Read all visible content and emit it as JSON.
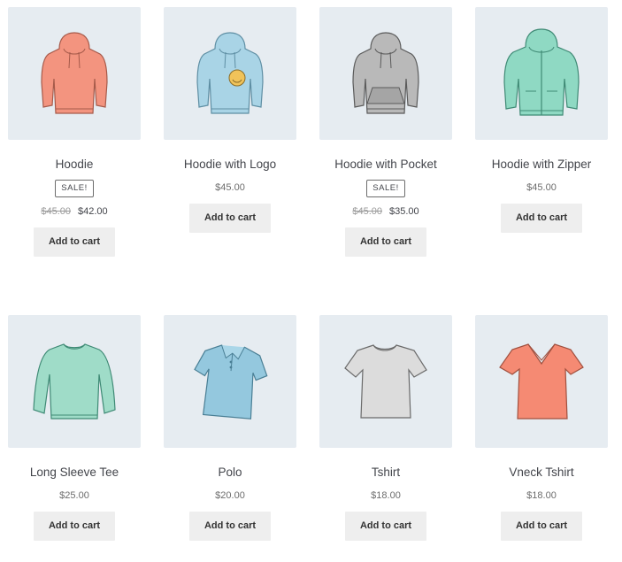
{
  "products": [
    {
      "name": "Hoodie",
      "badge": "SALE!",
      "regular_price": "$45.00",
      "sale_price": "$42.00",
      "button": "Add to cart",
      "icon": "hoodie-icon",
      "color": "#f3947f"
    },
    {
      "name": "Hoodie with Logo",
      "price": "$45.00",
      "button": "Add to cart",
      "icon": "hoodie-logo-icon",
      "color": "#a9d4e6"
    },
    {
      "name": "Hoodie with Pocket",
      "badge": "SALE!",
      "regular_price": "$45.00",
      "sale_price": "$35.00",
      "button": "Add to cart",
      "icon": "hoodie-pocket-icon",
      "color": "#b9b9b9"
    },
    {
      "name": "Hoodie with Zipper",
      "price": "$45.00",
      "button": "Add to cart",
      "icon": "hoodie-zipper-icon",
      "color": "#8fd9c3"
    },
    {
      "name": "Long Sleeve Tee",
      "price": "$25.00",
      "button": "Add to cart",
      "icon": "long-sleeve-tee-icon",
      "color": "#9fdcc8"
    },
    {
      "name": "Polo",
      "price": "$20.00",
      "button": "Add to cart",
      "icon": "polo-icon",
      "color": "#94c8de"
    },
    {
      "name": "Tshirt",
      "price": "$18.00",
      "button": "Add to cart",
      "icon": "tshirt-icon",
      "color": "#dcdcdc"
    },
    {
      "name": "Vneck Tshirt",
      "price": "$18.00",
      "button": "Add to cart",
      "icon": "vneck-tshirt-icon",
      "color": "#f58a73"
    }
  ]
}
